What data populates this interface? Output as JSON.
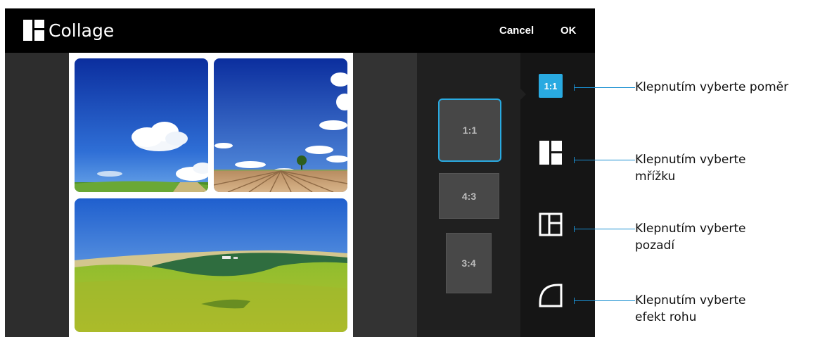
{
  "app": {
    "title": "Collage",
    "cancel_label": "Cancel",
    "ok_label": "OK"
  },
  "ratio_options": [
    {
      "label": "1:1",
      "selected": true
    },
    {
      "label": "4:3",
      "selected": false
    },
    {
      "label": "3:4",
      "selected": false
    }
  ],
  "toolbar": {
    "ratio_label": "1:1",
    "icons": [
      "ratio-icon",
      "grid-layout-icon",
      "background-icon",
      "corner-effect-icon"
    ]
  },
  "photos": [
    "cloud-sky-grass-photo",
    "field-tree-sky-photo",
    "green-hills-photo"
  ],
  "callouts": {
    "ratio": "Klepnutím vyberte poměr",
    "grid_line1": "Klepnutím vyberte",
    "grid_line2": "mřížku",
    "background_line1": "Klepnutím vyberte",
    "background_line2": "pozadí",
    "corner_line1": "Klepnutím vyberte",
    "corner_line2": "efekt rohu"
  },
  "colors": {
    "accent": "#29aae1",
    "appbar": "#000000",
    "panel": "#202020"
  }
}
